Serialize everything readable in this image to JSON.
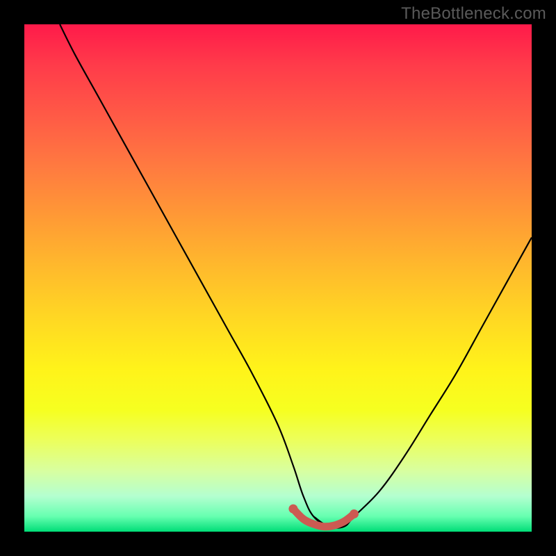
{
  "watermark": "TheBottleneck.com",
  "chart_data": {
    "type": "line",
    "title": "",
    "xlabel": "",
    "ylabel": "",
    "xlim": [
      0,
      100
    ],
    "ylim": [
      0,
      100
    ],
    "series": [
      {
        "name": "bottleneck-curve",
        "x": [
          7,
          10,
          15,
          20,
          25,
          30,
          35,
          40,
          45,
          50,
          53,
          55,
          57,
          60,
          63,
          65,
          70,
          75,
          80,
          85,
          90,
          95,
          100
        ],
        "y": [
          100,
          94,
          85,
          76,
          67,
          58,
          49,
          40,
          31,
          21,
          13,
          7,
          3,
          1,
          1,
          3,
          8,
          15,
          23,
          31,
          40,
          49,
          58
        ]
      },
      {
        "name": "sweet-spot-band",
        "x": [
          53,
          55,
          57,
          59,
          61,
          63,
          65
        ],
        "y": [
          4.5,
          2.5,
          1.5,
          1.0,
          1.2,
          2.0,
          3.5
        ]
      }
    ],
    "annotations": []
  },
  "colors": {
    "curve": "#000000",
    "band": "#cc5a52",
    "grad_top": "#ff1a4a",
    "grad_bottom": "#00dd77"
  }
}
